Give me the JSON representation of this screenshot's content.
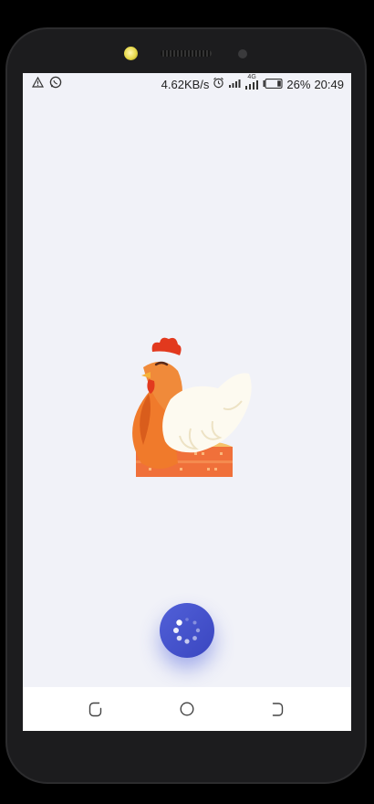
{
  "status_bar": {
    "network_speed": "4.62KB/s",
    "network_type": "4G",
    "battery_percent": "26%",
    "time": "20:49",
    "left_icons": [
      "alert-triangle-icon",
      "whatsapp-icon"
    ],
    "right_icons": [
      "alarm-icon",
      "signal-icon",
      "signal-4g-icon",
      "battery-icon"
    ]
  },
  "splash": {
    "illustration": "hen-on-nest",
    "loading": true,
    "accent_color": "#4556cf"
  },
  "navigation_bar": {
    "buttons": [
      "back",
      "home",
      "recent-apps"
    ]
  }
}
